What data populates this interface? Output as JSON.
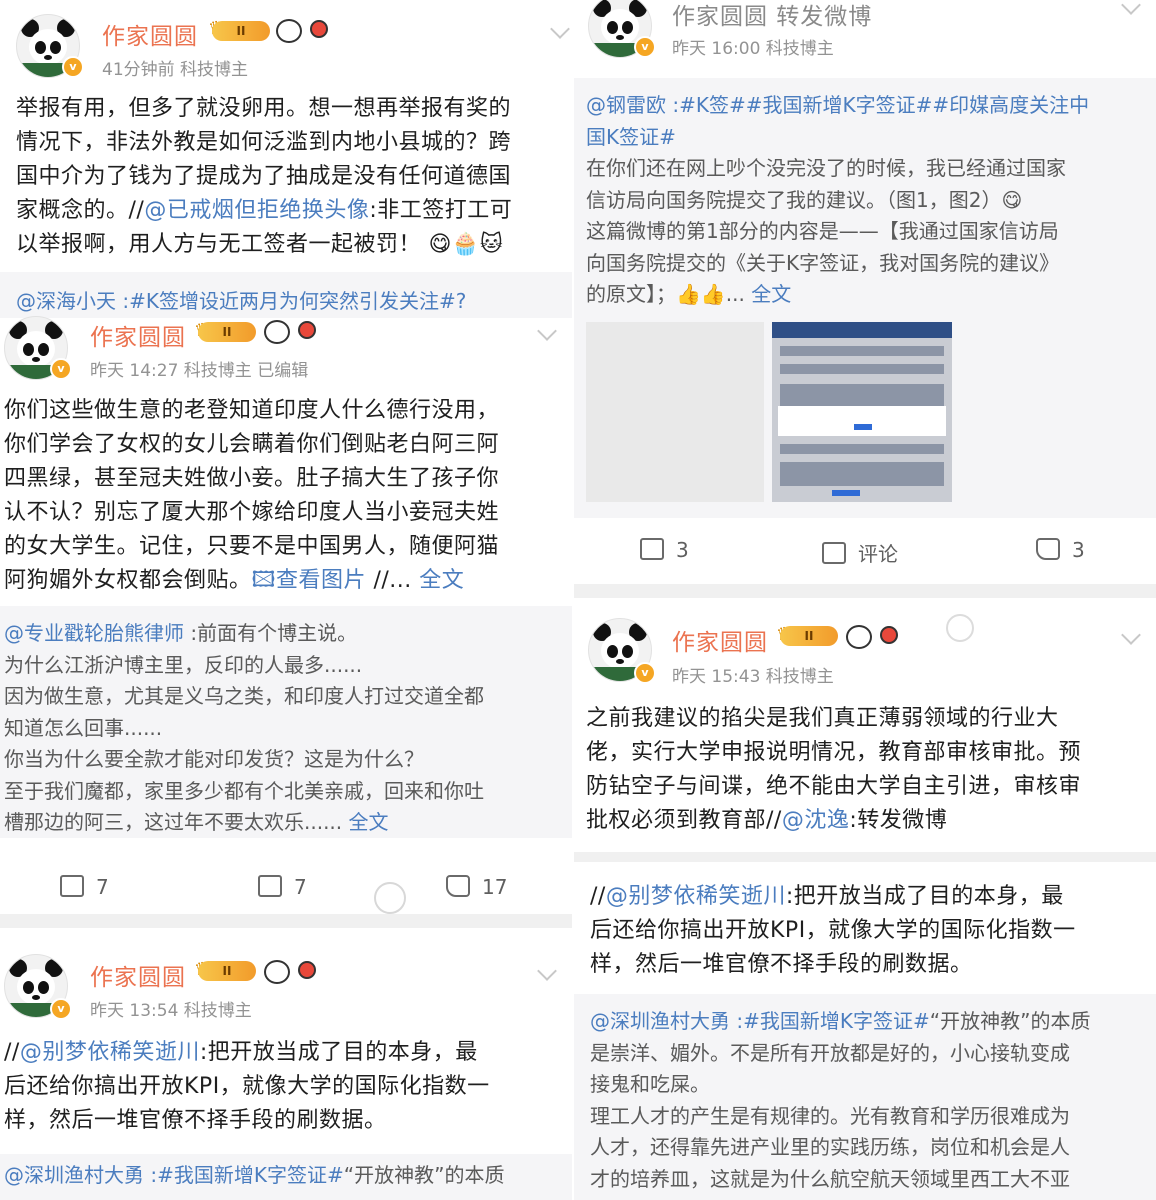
{
  "left": {
    "card1": {
      "author": "作家圆圆",
      "level_badge": "II",
      "meta": "41分钟前   科技博主",
      "text_lines": [
        "举报有用，但多了就没卵用。想一想再举报有奖的",
        "情况下，非法外教是如何泛滥到内地小县城的？跨",
        "国中介为了钱为了提成为了抽成是没有任何道德国"
      ],
      "line4_pre": "家概念的。//",
      "line4_link": "@已戒烟但拒绝换头像",
      "line4_post": ":非工签打工可",
      "line5": "以举报啊，用人方与无工签者一起被罚！ 😋🧁🐱"
    },
    "peek1_repost": "@深海小天 :#K签增设近两月为何突然引发关注#?",
    "card2": {
      "author": "作家圆圆",
      "level_badge": "II",
      "meta": "昨天 14:27   科技博主   已编辑",
      "text_lines": [
        "你们这些做生意的老登知道印度人什么德行没用，",
        "你们学会了女权的女儿会瞒着你们倒贴老白阿三阿",
        "四黑绿，甚至冠夫姓做小妾。肚子搞大生了孩子你",
        "认不认？别忘了厦大那个嫁给印度人当小妾冠夫姓",
        "的女大学生。记住，只要不是中国男人，随便阿猫"
      ],
      "line6_pre": "阿狗媚外女权都会倒贴。",
      "line6_link": "🖾查看图片",
      "line6_mid": " //...",
      "line6_more": " 全文",
      "repost_link": "@专业戳轮胎熊律师",
      "repost_after": " :前面有个博主说。",
      "repost_lines": [
        "为什么江浙沪博主里，反印的人最多......",
        "因为做生意，尤其是义乌之类，和印度人打过交道全都",
        "知道怎么回事......",
        "你当为什么要全款才能对印发货？这是为什么？",
        "至于我们魔都，家里多少都有个北美亲戚，回来和你吐"
      ],
      "repost_last": "槽那边的阿三，这过年不要太欢乐......",
      "repost_more": " 全文",
      "share_count": "7",
      "comment_count": "7",
      "like_count": "17"
    },
    "card3": {
      "author": "作家圆圆",
      "level_badge": "II",
      "meta": "昨天 13:54   科技博主",
      "line1_pre": "//",
      "line1_link": "@别梦依稀笑逝川",
      "line1_post": ":把开放当成了目的本身，最",
      "text_lines": [
        "后还给你搞出开放KPI，就像大学的国际化指数一",
        "样，然后一堆官僚不择手段的刷数据。"
      ],
      "repost_link": "@深圳渔村大勇 :#我国新增K字签证#",
      "repost_after": "“开放神教”的本质"
    }
  },
  "right": {
    "card1": {
      "author": "作家圆圆",
      "author_suffix": " 转发微博",
      "meta": "昨天 16:00   科技博主",
      "repost_head": "@钢雷欧 :#K签##我国新增K字签证##印媒高度关注中",
      "repost_head2": "国K签证#",
      "repost_lines": [
        "在你们还在网上吵个没完没了的时候，我已经通过国家",
        "信访局向国务院提交了我的建议。（图1，图2）😋",
        "这篇微博的第1部分的内容是——【我通过国家信访局",
        "向国务院提交的《关于K字签证，我对国务院的建议》"
      ],
      "repost_last": "的原文】；👍👍...",
      "repost_more": " 全文",
      "share_count": "3",
      "comment_label": "评论",
      "like_count": "3"
    },
    "card2": {
      "author": "作家圆圆",
      "level_badge": "II",
      "meta": "昨天 15:43   科技博主",
      "text_lines": [
        "之前我建议的掐尖是我们真正薄弱领域的行业大",
        "佬，实行大学申报说明情况，教育部审核审批。预",
        "防钻空子与间谍，绝不能由大学自主引进，审核审"
      ],
      "line4_pre": "批权必须到教育部//",
      "line4_link": "@沈逸",
      "line4_post": ":转发微博"
    },
    "card3": {
      "line1_pre": "//",
      "line1_link": "@别梦依稀笑逝川",
      "line1_post": ":把开放当成了目的本身，最",
      "text_lines": [
        "后还给你搞出开放KPI，就像大学的国际化指数一",
        "样，然后一堆官僚不择手段的刷数据。"
      ],
      "repost_link": "@深圳渔村大勇 :#我国新增K字签证#",
      "repost_after": "“开放神教”的本质",
      "repost_lines": [
        "是崇洋、媚外。不是所有开放都是好的，小心接轨变成",
        "接鬼和吃屎。",
        "理工人才的产生是有规律的。光有教育和学历很难成为",
        "人才，还得靠先进产业里的实践历练，岗位和机会是人",
        "才的培养皿，这就是为什么航空航天领域里西工大不亚"
      ]
    }
  },
  "colors": {
    "name": "#eb7350",
    "link": "#4b7dbf",
    "meta": "#939393",
    "text": "#1f1f1f"
  }
}
